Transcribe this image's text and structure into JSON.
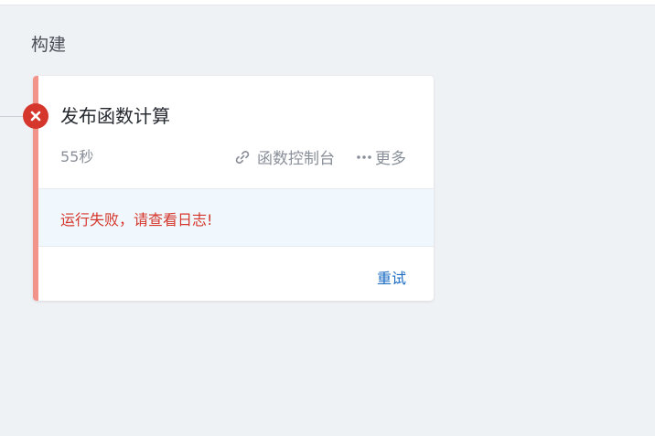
{
  "stage": {
    "title": "构建"
  },
  "job": {
    "name": "发布函数计算",
    "duration": "55秒",
    "status": "failed",
    "status_icon": "close-icon",
    "console_label": "函数控制台",
    "console_icon": "link-icon",
    "more_label": "更多",
    "more_icon": "ellipsis-icon",
    "error_message": "运行失败，请查看日志!",
    "retry_label": "重试"
  },
  "colors": {
    "accent_failed": "#f3948a",
    "status_failed": "#d5372c",
    "link_blue": "#1a6bc4",
    "error_bg": "#f0f7fd"
  }
}
